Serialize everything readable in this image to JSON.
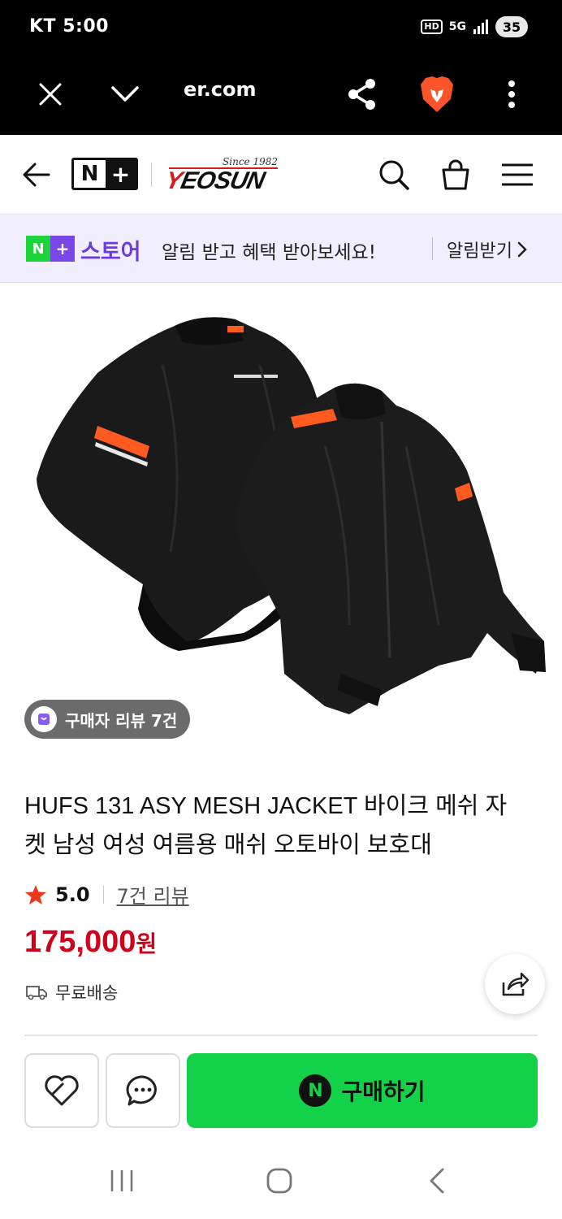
{
  "status_bar": {
    "carrier_time": "KT 5:00",
    "hd": "HD",
    "network": "5G",
    "battery": "35"
  },
  "browser": {
    "url": "er.com"
  },
  "header": {
    "logo_n": "N",
    "logo_plus": "+",
    "brand_since": "Since 1982",
    "brand_name_first": "Y",
    "brand_name_rest": "EOSUN"
  },
  "promo": {
    "badge_n": "N",
    "badge_plus": "+",
    "store_label": "스토어",
    "message": "알림 받고 혜택 받아보세요!",
    "cta_label": "알림받기"
  },
  "product": {
    "review_pill": "구매자 리뷰 7건",
    "title": "HUFS 131 ASY MESH JACKET 바이크 메쉬 자켓 남성 여성 여름용 매쉬 오토바이 보호대",
    "rating": "5.0",
    "review_link": "7건 리뷰",
    "price_amount": "175,000",
    "price_unit": "원",
    "shipping": "무료배송"
  },
  "actions": {
    "buy_n": "N",
    "buy_label": "구매하기"
  },
  "colors": {
    "accent_green": "#14d14a",
    "price_red": "#d0021b",
    "promo_purple": "#6b3be0",
    "promo_bg": "#f1eefd"
  }
}
